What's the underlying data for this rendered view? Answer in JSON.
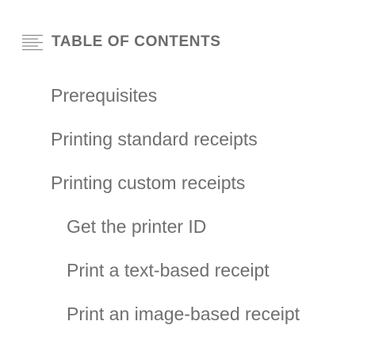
{
  "toc": {
    "title": "TABLE OF CONTENTS",
    "icon": "list-lines-icon",
    "text_color": "#6f6f6f",
    "items": [
      {
        "label": "Prerequisites",
        "level": 1
      },
      {
        "label": "Printing standard receipts",
        "level": 1
      },
      {
        "label": "Printing custom receipts",
        "level": 1
      },
      {
        "label": "Get the printer ID",
        "level": 2
      },
      {
        "label": "Print a text-based receipt",
        "level": 2
      },
      {
        "label": "Print an image-based receipt",
        "level": 2
      }
    ]
  }
}
